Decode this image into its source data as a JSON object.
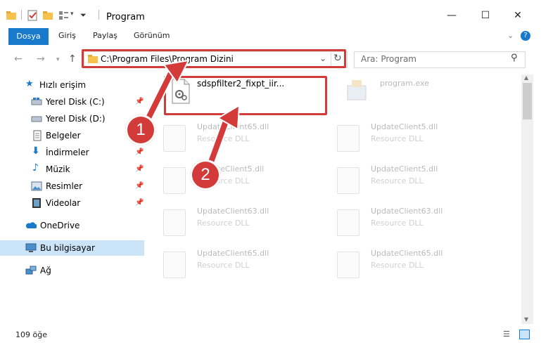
{
  "window": {
    "title": "Program",
    "minimize": "—",
    "maximize": "☐",
    "close": "✕"
  },
  "ribbon": {
    "tabs": [
      "Dosya",
      "Giriş",
      "Paylaş",
      "Görünüm"
    ]
  },
  "nav": {
    "address": "C:\\Program Files\\Program Dizini",
    "search_placeholder": "Ara: Program"
  },
  "sidebar": {
    "items": [
      {
        "label": "Hızlı erişim",
        "icon": "star-icon"
      },
      {
        "label": "Yerel Disk (C:)",
        "icon": "drive-icon"
      },
      {
        "label": "Yerel Disk (D:)",
        "icon": "drive-icon"
      },
      {
        "label": "Belgeler",
        "icon": "document-icon"
      },
      {
        "label": "İndirmeler",
        "icon": "download-icon"
      },
      {
        "label": "Müzik",
        "icon": "music-icon"
      },
      {
        "label": "Resimler",
        "icon": "pictures-icon"
      },
      {
        "label": "Videolar",
        "icon": "video-icon"
      },
      {
        "label": "OneDrive",
        "icon": "cloud-icon"
      },
      {
        "label": "Bu bilgisayar",
        "icon": "computer-icon"
      },
      {
        "label": "Ağ",
        "icon": "network-icon"
      }
    ]
  },
  "files": {
    "selected": "sdspfilter2_fixpt_iir...",
    "program_exe": "program.exe",
    "tiles": [
      {
        "name": "UpdateClient65.dll",
        "type": "Resource DLL"
      },
      {
        "name": "UpdateClient5.dll",
        "type": "Resource DLL"
      },
      {
        "name": "UpdateClient5.dll",
        "type": "Resource DLL"
      },
      {
        "name": "UpdateClient5.dll",
        "type": "Resource DLL"
      },
      {
        "name": "UpdateClient63.dll",
        "type": "Resource DLL"
      },
      {
        "name": "UpdateClient63.dll",
        "type": "Resource DLL"
      },
      {
        "name": "UpdateClient65.dll",
        "type": "Resource DLL"
      },
      {
        "name": "UpdateClient65.dll",
        "type": "Resource DLL"
      }
    ]
  },
  "markers": [
    "1",
    "2"
  ],
  "status": {
    "count": "109 öğe"
  },
  "colors": {
    "accent": "#1979ca",
    "highlight": "#d33a3a"
  }
}
